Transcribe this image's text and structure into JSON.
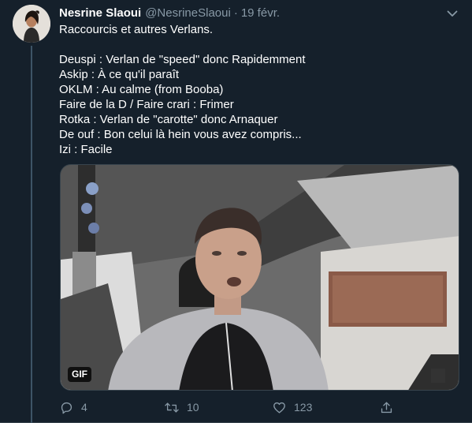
{
  "tweet": {
    "author": {
      "display_name": "Nesrine Slaoui",
      "handle": "@NesrineSlaoui",
      "avatar_icon": "profile-photo"
    },
    "separator": "·",
    "date": "19 févr.",
    "text_lines": [
      "Raccourcis et autres Verlans.",
      "",
      "Deuspi : Verlan de \"speed\" donc Rapidemment",
      "Askip : À ce qu'il paraît",
      "OKLM : Au calme (from Booba)",
      "Faire de la D / Faire crari : Frimer",
      "Rotka : Verlan de \"carotte\" donc Arnaquer",
      "De ouf : Bon celui là hein vous avez compris...",
      "Izi : Facile"
    ],
    "media": {
      "type": "gif",
      "badge": "GIF"
    },
    "actions": {
      "reply_count": "4",
      "retweet_count": "10",
      "like_count": "123"
    }
  },
  "colors": {
    "background": "#15202b",
    "secondary_text": "#8899a6",
    "border": "#38444d"
  }
}
